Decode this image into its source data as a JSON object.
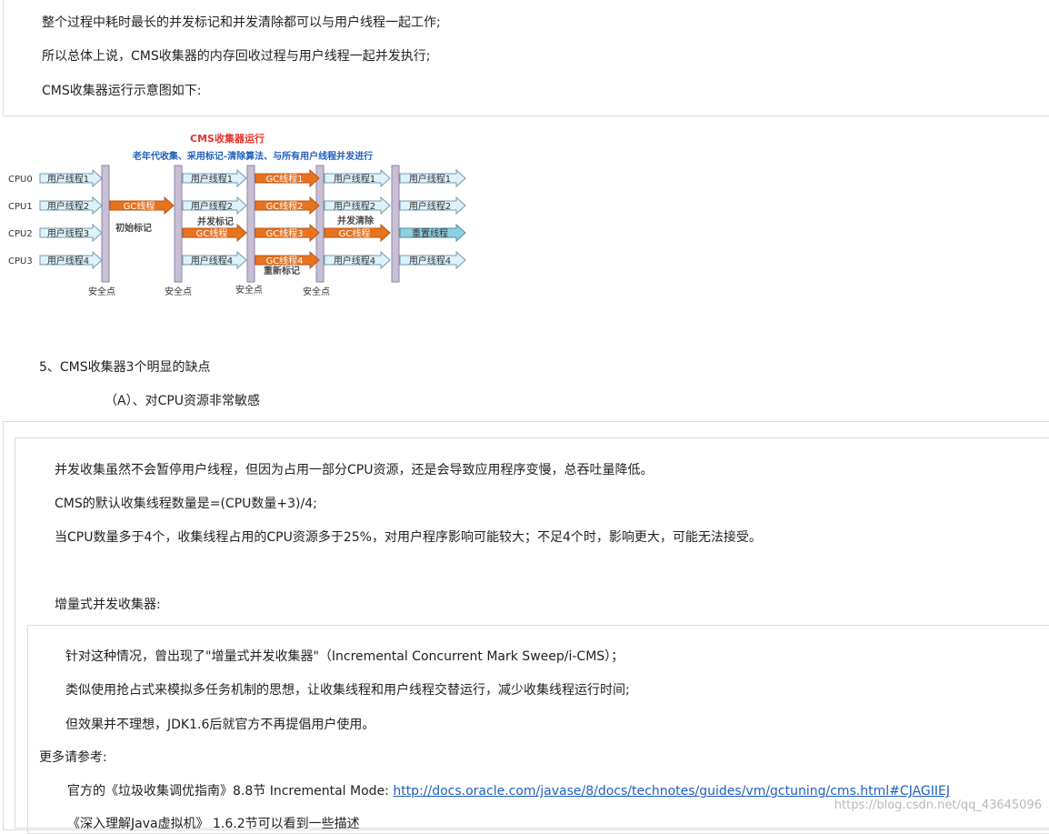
{
  "top_block": {
    "lines": [
      "整个过程中耗时最长的并发标记和并发清除都可以与用户线程一起工作;",
      "所以总体上说，CMS收集器的内存回收过程与用户线程一起并发执行;",
      "CMS收集器运行示意图如下:"
    ]
  },
  "diagram": {
    "title": "CMS收集器运行",
    "subtitle": "老年代收集、采用标记-清除算法、与所有用户线程并发进行",
    "cpus": [
      "CPU0",
      "CPU1",
      "CPU2",
      "CPU3"
    ],
    "user_threads": [
      "用户线程1",
      "用户线程2",
      "用户线程3",
      "用户线程4"
    ],
    "gc_thread": "GC线程",
    "gc_threads": [
      "GC线程1",
      "GC线程2",
      "GC线程3",
      "GC线程4"
    ],
    "reset_thread": "重置线程",
    "phase_labels": [
      "初始标记",
      "并发标记",
      "重新标记",
      "并发清除"
    ],
    "safepoint": "安全点",
    "colors": {
      "title": "#e8322c",
      "subtitle": "#1f5fbf",
      "gc": "#e8731f",
      "user": "#dff1f9",
      "reset": "#8fcfe0",
      "bar": "#c8bfd6"
    }
  },
  "section5": {
    "heading": "5、CMS收集器3个明显的缺点",
    "sub": "（A）、对CPU资源非常敏感"
  },
  "box2": {
    "lines": [
      "并发收集虽然不会暂停用户线程，但因为占用一部分CPU资源，还是会导致应用程序变慢，总吞吐量降低。",
      "CMS的默认收集线程数量是=(CPU数量+3)/4;",
      "当CPU数量多于4个，收集线程占用的CPU资源多于25%，对用户程序影响可能较大；不足4个时，影响更大，可能无法接受。",
      "增量式并发收集器:"
    ]
  },
  "box3": {
    "lines": [
      "针对这种情况，曾出现了\"增量式并发收集器\"（Incremental Concurrent Mark Sweep/i-CMS）；",
      "类似使用抢占式来模拟多任务机制的思想，让收集线程和用户线程交替运行，减少收集线程运行时间;",
      "但效果并不理想，JDK1.6后就官方不再提倡用户使用。"
    ]
  },
  "more": {
    "label": "更多请参考:",
    "ref_prefix": "官方的《垃圾收集调优指南》8.8节 Incremental Mode:",
    "ref_url": "http://docs.oracle.com/javase/8/docs/technotes/guides/vm/gctuning/cms.html#CJAGIIEJ",
    "cut_line": "《深入理解Java虚拟机》 1.6.2节可以看到一些描述"
  },
  "watermark": "https://blog.csdn.net/qq_43645096"
}
